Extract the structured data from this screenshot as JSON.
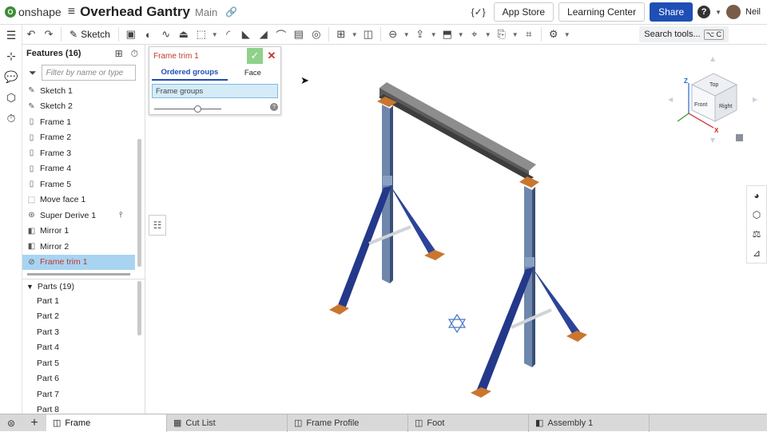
{
  "app": {
    "logo_mark": "O",
    "logo_text": "onshape",
    "doc_title": "Overhead Gantry",
    "branch": "Main",
    "variables_label": "{✓}",
    "buttons": {
      "app_store": "App Store",
      "learning_center": "Learning Center",
      "share": "Share"
    },
    "user_name": "Neil",
    "help_glyph": "?",
    "colors": {
      "brand_green": "#3d8b37",
      "share_blue": "#1f4fb5",
      "active_red": "#c0392b",
      "selection_blue": "#a8d4f2"
    }
  },
  "toolbar": {
    "sketch_label": "Sketch",
    "search_label": "Search tools...",
    "search_kbd": "⌥ C"
  },
  "features": {
    "header": "Features (16)",
    "filter_placeholder": "Filter by name or type",
    "items": [
      {
        "label": "Sketch 1",
        "icon": "sketch-icon"
      },
      {
        "label": "Sketch 2",
        "icon": "sketch-icon"
      },
      {
        "label": "Frame 1",
        "icon": "frame-icon"
      },
      {
        "label": "Frame 2",
        "icon": "frame-icon"
      },
      {
        "label": "Frame 3",
        "icon": "frame-icon"
      },
      {
        "label": "Frame 4",
        "icon": "frame-icon"
      },
      {
        "label": "Frame 5",
        "icon": "frame-icon"
      },
      {
        "label": "Move face 1",
        "icon": "move-face-icon"
      },
      {
        "label": "Super Derive 1",
        "icon": "derive-icon"
      },
      {
        "label": "Mirror 1",
        "icon": "mirror-icon"
      },
      {
        "label": "Mirror 2",
        "icon": "mirror-icon"
      },
      {
        "label": "Frame trim 1",
        "icon": "frame-trim-icon",
        "active": true
      }
    ]
  },
  "parts": {
    "header": "Parts (19)",
    "items": [
      "Part 1",
      "Part 2",
      "Part 3",
      "Part 4",
      "Part 5",
      "Part 6",
      "Part 7",
      "Part 8"
    ]
  },
  "dialog": {
    "title": "Frame trim 1",
    "tab_ordered": "Ordered groups",
    "tab_face": "Face",
    "field_label": "Frame groups",
    "slider_value": 0.65
  },
  "viewcube": {
    "top": "Top",
    "front": "Front",
    "right": "Right",
    "x": "X",
    "z": "Z"
  },
  "tabs": [
    {
      "label": "Frame",
      "active": true
    },
    {
      "label": "Cut List"
    },
    {
      "label": "Frame Profile"
    },
    {
      "label": "Foot"
    },
    {
      "label": "Assembly 1"
    }
  ]
}
